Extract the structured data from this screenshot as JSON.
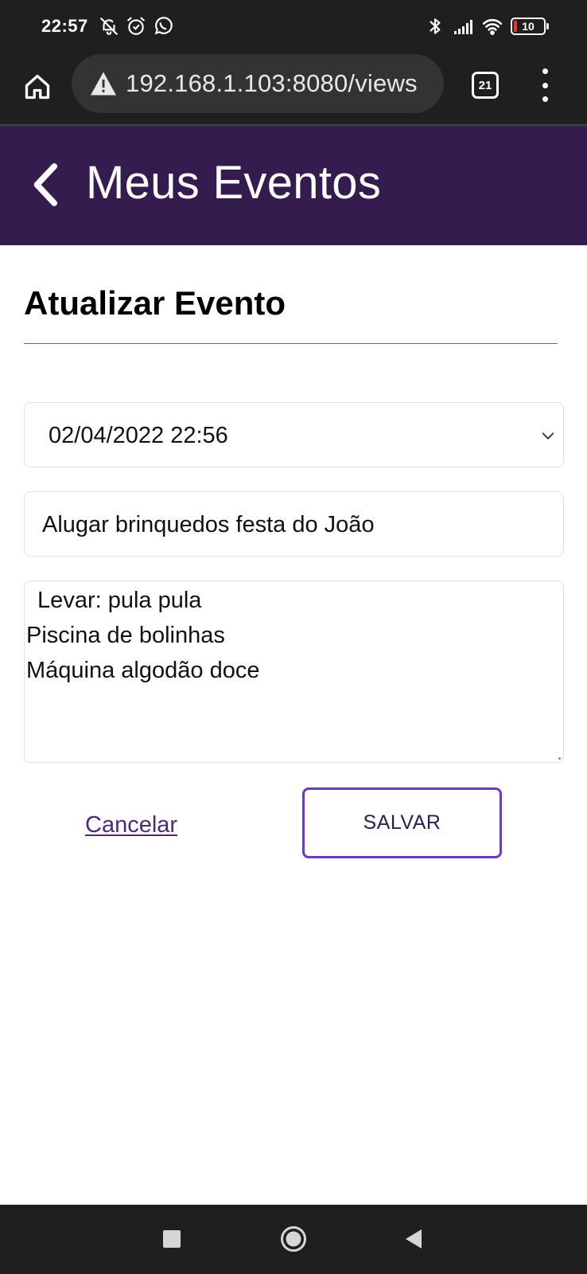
{
  "status_bar": {
    "time": "22:57",
    "battery_level": "10",
    "left_icons": [
      "muted-bell-icon",
      "alarm-icon",
      "whatsapp-icon"
    ],
    "right_icons": [
      "bluetooth-icon",
      "signal-icon",
      "wifi-icon",
      "battery-icon"
    ]
  },
  "browser": {
    "url": "192.168.1.103:8080/views",
    "tab_count": "21",
    "security_icon": "warning-triangle-icon"
  },
  "header": {
    "title": "Meus Eventos"
  },
  "form": {
    "heading": "Atualizar Evento",
    "datetime_value": "02/04/2022 22:56",
    "title_value": "Alugar brinquedos festa do João",
    "description_lines": [
      " Levar: pula pula",
      "Piscina de bolinhas",
      "Máquina algodão doce"
    ],
    "cancel_label": "Cancelar",
    "save_label": "SALVAR"
  },
  "colors": {
    "header_bg": "#341c4e",
    "system_bar_bg": "#1f1f1f",
    "accent_border": "#6a3bc0",
    "link": "#4a2b77"
  }
}
